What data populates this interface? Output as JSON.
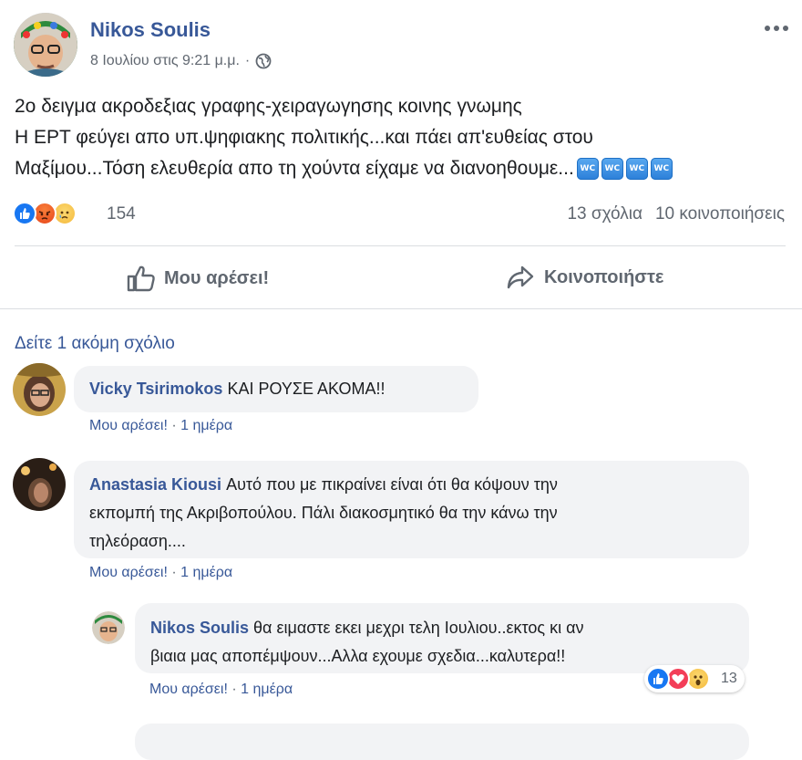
{
  "post": {
    "author": "Nikos Soulis",
    "timestamp": "8 Ιουλίου στις 9:21 μ.μ.",
    "separator": "·",
    "privacy_icon": "globe-icon",
    "more_icon": "ellipsis-icon",
    "text_lines": [
      "2ο δειγμα ακροδεξιας γραφης-χειραγωγησης κοινης γνωμης",
      "Η ΕΡΤ φεύγει απο υπ.ψηφιακης πολιτικής...και πάει απ'ευθείας στου",
      "Μαξίμου...Τόση ελευθερία απο τη χούντα είχαμε να διανοηθουμε..."
    ],
    "emoji_label": "WC",
    "emoji_count": 4,
    "reactions_count": "154",
    "reaction_icons": [
      "like-icon",
      "angry-icon",
      "sad-icon"
    ],
    "comments_count": "13 σχόλια",
    "shares_count": "10 κοινοποιήσεις"
  },
  "actions": {
    "like_label": "Μου αρέσει!",
    "share_label": "Κοινοποιήστε"
  },
  "comments_section": {
    "view_more": "Δείτε 1 ακόμη σχόλιο",
    "comments": [
      {
        "author": "Vicky Tsirimokos",
        "text": "ΚΑΙ ΡΟΥΣΕ ΑΚΟΜΑ!!",
        "like_label": "Μου αρέσει!",
        "time": "1 ημέρα"
      },
      {
        "author": "Anastasia Kiousi",
        "text_line1": "Αυτό που με πικραίνει είναι ότι θα κόψουν την",
        "text_line2": "εκπομπή της Ακριβοπούλου. Πάλι διακοσμητικό θα την κάνω την",
        "text_line3": "τηλεόραση....",
        "like_label": "Μου αρέσει!",
        "time": "1 ημέρα"
      }
    ],
    "reply": {
      "author": "Nikos Soulis",
      "text_line1": "θα ειμαστε εκει μεχρι τελη Ιουλιου..εκτος κι αν",
      "text_line2": "βιαια μας αποπέμψουν...Αλλα εχουμε σχεδια...καλυτερα!!",
      "like_label": "Μου αρέσει!",
      "time": "1 ημέρα",
      "reactions_count": "13",
      "reaction_icons": [
        "like-icon",
        "love-icon",
        "wow-icon"
      ]
    },
    "meta_separator": "·"
  },
  "colors": {
    "link_blue": "#385898",
    "fb_blue": "#1877f2",
    "meta_gray": "#606770",
    "bubble_bg": "#f2f3f5",
    "divider": "#dadde1"
  }
}
